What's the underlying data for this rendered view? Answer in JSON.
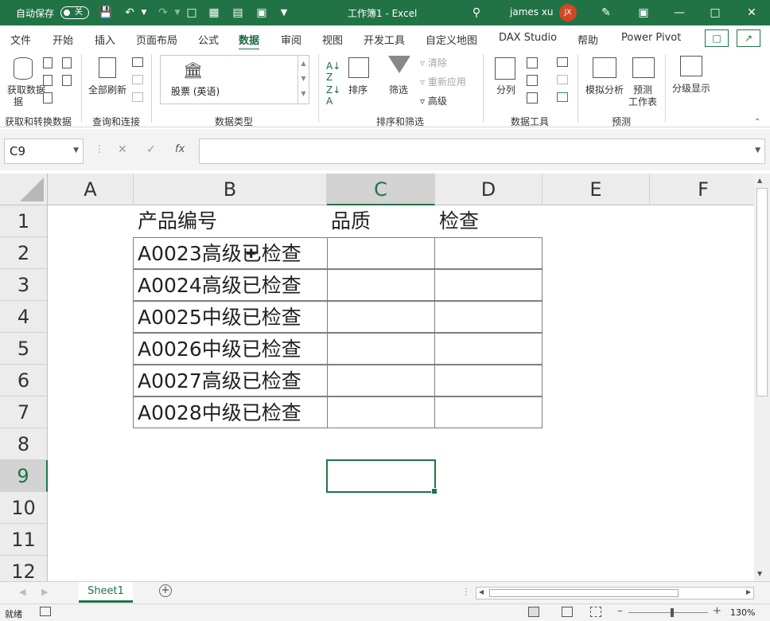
{
  "titlebar": {
    "autosave_label": "自动保存",
    "autosave_state": "关",
    "document_title": "工作簿1  -  Excel",
    "user_name": "james xu",
    "user_initials": "JX"
  },
  "menu": {
    "tabs": [
      "文件",
      "开始",
      "插入",
      "页面布局",
      "公式",
      "数据",
      "审阅",
      "视图",
      "开发工具",
      "自定义地图",
      "DAX Studio",
      "帮助",
      "Power Pivot"
    ],
    "active_tab": "数据"
  },
  "ribbon": {
    "get_data": "获取数据",
    "get_data_2": "据",
    "refresh_all": "全部刷新",
    "stock_type": "股票 (英语)",
    "sort": "排序",
    "filter": "筛选",
    "clear": "清除",
    "reapply": "重新应用",
    "advanced": "高级",
    "split_column": "分列",
    "what_if": "模拟分析",
    "forecast_sheet_1": "预测",
    "forecast_sheet_2": "工作表",
    "outline": "分级显示",
    "groups": {
      "get_transform": "获取和转换数据",
      "queries": "查询和连接",
      "data_types": "数据类型",
      "sort_filter": "排序和筛选",
      "data_tools": "数据工具",
      "forecast": "预测"
    }
  },
  "formula_bar": {
    "name_box": "C9",
    "fx_label": "fx",
    "formula": ""
  },
  "grid": {
    "columns": [
      "A",
      "B",
      "C",
      "D",
      "E",
      "F"
    ],
    "selected_column": "C",
    "rows": [
      "1",
      "2",
      "3",
      "4",
      "5",
      "6",
      "7",
      "8",
      "9",
      "10",
      "11",
      "12"
    ],
    "selected_row": "9",
    "header_row": {
      "B": "产品编号",
      "C": "品质",
      "D": "检查"
    },
    "data_rows": [
      "A0023高级已检查",
      "A0024高级已检查",
      "A0025中级已检查",
      "A0026中级已检查",
      "A0027高级已检查",
      "A0028中级已检查"
    ]
  },
  "sheet_tabs": [
    "Sheet1"
  ],
  "status_bar": {
    "ready": "就绪",
    "zoom": "130%"
  }
}
